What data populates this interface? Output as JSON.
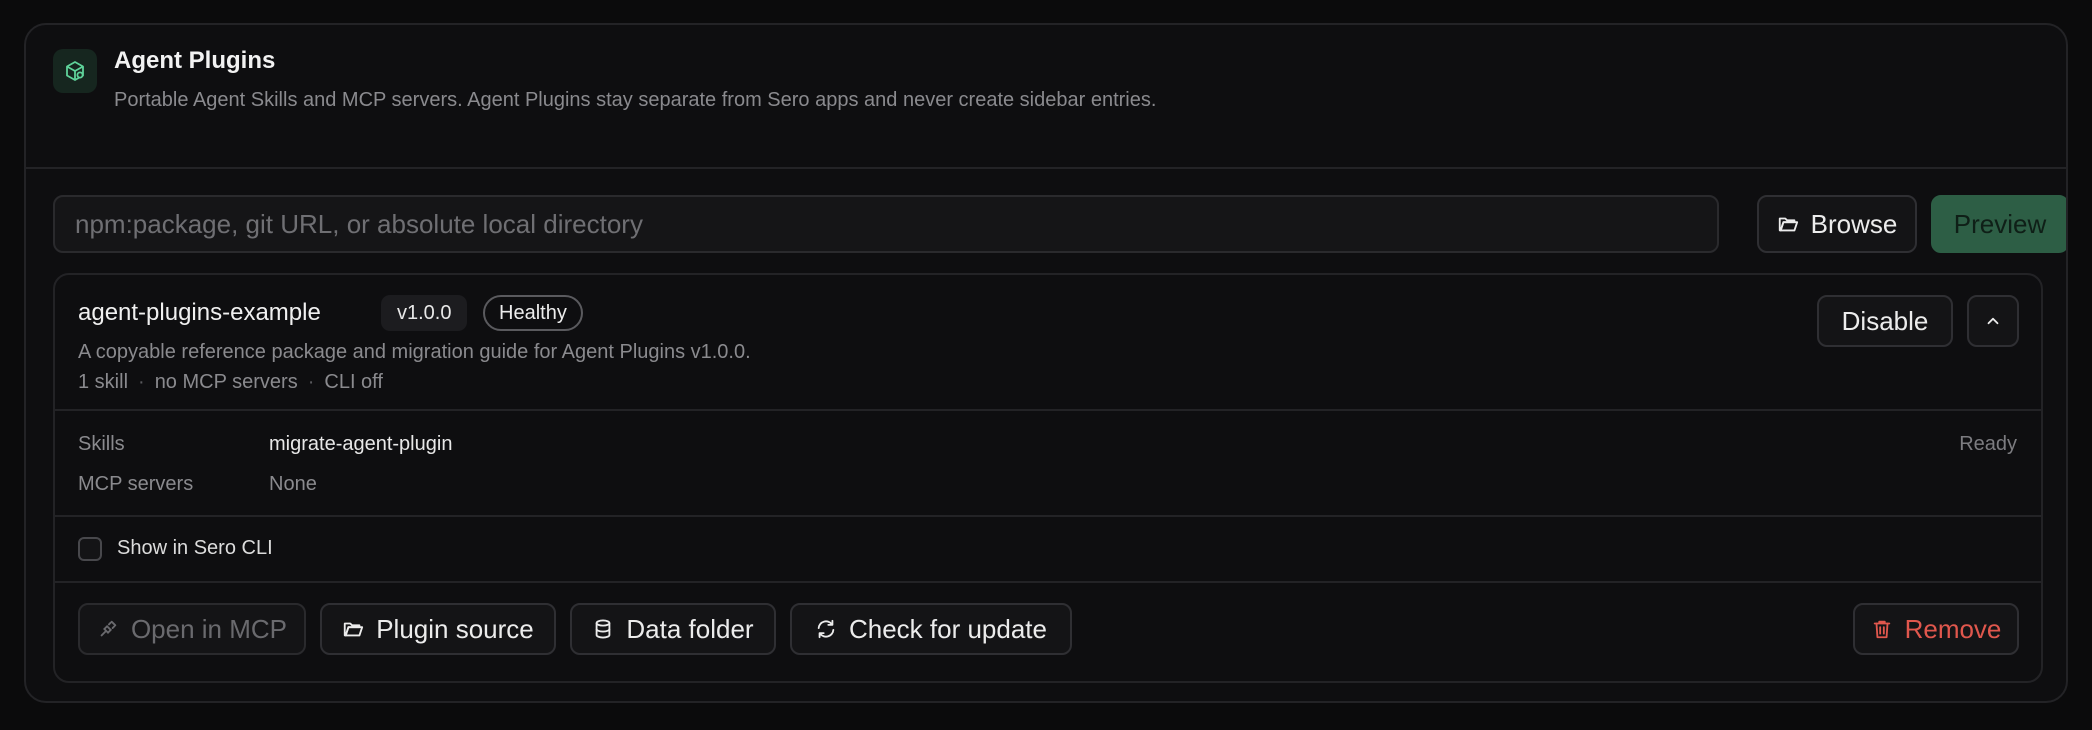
{
  "header": {
    "title": "Agent Plugins",
    "description": "Portable Agent Skills and MCP servers. Agent Plugins stay separate from Sero apps and never create sidebar entries.",
    "icon": "plugin-package-icon"
  },
  "install": {
    "placeholder": "npm:package, git URL, or absolute local directory",
    "value": "",
    "browse_label": "Browse",
    "preview_label": "Preview"
  },
  "plugin": {
    "name": "agent-plugins-example",
    "version": "v1.0.0",
    "health": "Healthy",
    "description": "A copyable reference package and migration guide for Agent Plugins v1.0.0.",
    "meta": [
      "1 skill",
      "no MCP servers",
      "CLI off"
    ],
    "disable_label": "Disable",
    "details": {
      "skills_label": "Skills",
      "skills_value": "migrate-agent-plugin",
      "skills_status": "Ready",
      "mcp_label": "MCP servers",
      "mcp_value": "None"
    },
    "cli": {
      "label": "Show in Sero CLI",
      "checked": false
    },
    "actions": {
      "open_mcp": "Open in MCP",
      "plugin_source": "Plugin source",
      "data_folder": "Data folder",
      "check_update": "Check for update",
      "remove": "Remove"
    }
  },
  "colors": {
    "accent": "#2d5e45",
    "danger": "#e0574d",
    "background": "#0b0b0c"
  }
}
